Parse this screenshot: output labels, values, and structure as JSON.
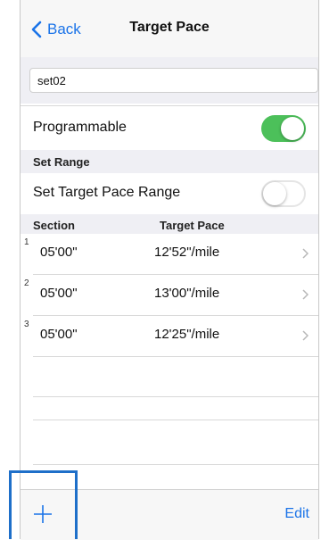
{
  "nav": {
    "back_label": "Back",
    "title": "Target Pace"
  },
  "name_field": {
    "value": "set02",
    "placeholder": ""
  },
  "programmable": {
    "label": "Programmable",
    "enabled": true
  },
  "set_range": {
    "header": "Set Range",
    "toggle_label": "Set Target Pace Range",
    "enabled": false
  },
  "table": {
    "headers": {
      "section": "Section",
      "target_pace": "Target Pace"
    },
    "rows": [
      {
        "index": "1",
        "section": "05'00\"",
        "pace": "12'52\"/mile"
      },
      {
        "index": "2",
        "section": "05'00\"",
        "pace": "13'00\"/mile"
      },
      {
        "index": "3",
        "section": "05'00\"",
        "pace": "12'25\"/mile"
      }
    ]
  },
  "toolbar": {
    "edit_label": "Edit"
  },
  "colors": {
    "accent": "#1a73e8",
    "toggle_on": "#4cc05a",
    "highlight": "#1e6fc9"
  },
  "icons": {
    "back": "chevron-left-icon",
    "row": "chevron-right-icon",
    "add": "plus-icon"
  }
}
